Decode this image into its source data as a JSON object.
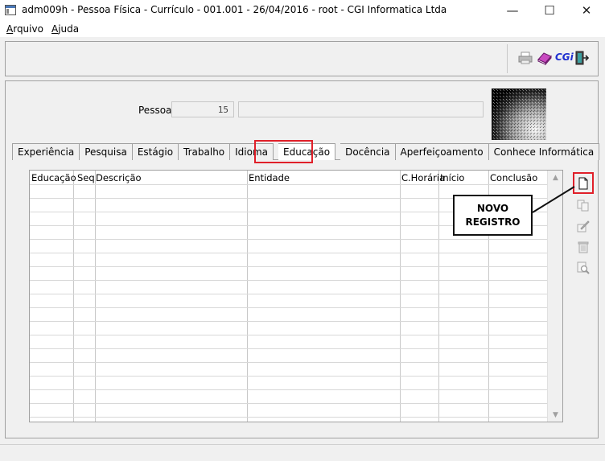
{
  "window": {
    "title": "adm009h - Pessoa Física - Currículo - 001.001 - 26/04/2016 - root - CGI Informatica Ltda",
    "minimize": "—",
    "maximize": "☐",
    "close": "✕"
  },
  "menu": {
    "items": [
      {
        "u": "A",
        "rest": "rquivo"
      },
      {
        "u": "A",
        "rest": "juda"
      }
    ]
  },
  "toolbar": {
    "cgi_label": "CGi",
    "icons": [
      "printer-icon",
      "book-icon",
      "cgi-logo-icon",
      "exit-door-icon"
    ]
  },
  "form": {
    "pessoa_label": "Pessoa:",
    "pessoa_code": "15",
    "pessoa_name": ""
  },
  "tabs": [
    {
      "label": "Experiência"
    },
    {
      "label": "Pesquisa"
    },
    {
      "label": "Estágio"
    },
    {
      "label": "Trabalho"
    },
    {
      "label": "Idioma"
    },
    {
      "label": "Educação",
      "active": true
    },
    {
      "label": "Docência"
    },
    {
      "label": "Aperfeiçoamento"
    },
    {
      "label": "Conhece Informática"
    }
  ],
  "grid": {
    "columns": [
      "Educação",
      "Seq",
      "Descrição",
      "Entidade",
      "C.Horária",
      "Início",
      "Conclusão"
    ],
    "rows": []
  },
  "side_actions": [
    "new-record-icon",
    "copy-icon",
    "edit-icon",
    "delete-icon",
    "search-icon"
  ],
  "callout": {
    "line1": "NOVO",
    "line2": "REGISTRO"
  },
  "colors": {
    "highlight": "#e0202a"
  }
}
